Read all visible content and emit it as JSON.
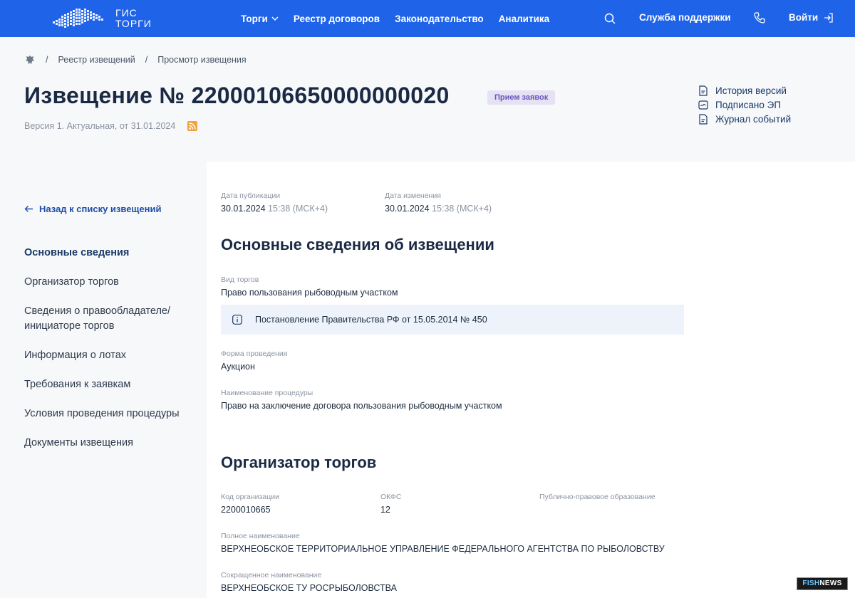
{
  "topbar": {
    "logo_text": [
      "ГИС",
      "ТОРГИ"
    ],
    "nav": [
      {
        "label": "Торги",
        "has_dropdown": true
      },
      {
        "label": "Реестр договоров"
      },
      {
        "label": "Законодательство"
      },
      {
        "label": "Аналитика"
      }
    ],
    "support_label": "Служба поддержки",
    "login_label": "Войти"
  },
  "breadcrumb": {
    "items": [
      "Реестр извещений",
      "Просмотр извещения"
    ],
    "separator": "/"
  },
  "notice": {
    "title": "Извещение № 22000106650000000020",
    "status_badge": "Прием заявок",
    "version_text": "Версия 1. Актуальная, от 31.01.2024"
  },
  "header_links": [
    {
      "label": "История версий",
      "icon": "document-icon"
    },
    {
      "label": "Подписано ЭП",
      "icon": "signature-icon"
    },
    {
      "label": "Журнал событий",
      "icon": "document-icon"
    }
  ],
  "sidebar": {
    "back_label": "Назад к списку извещений",
    "items": [
      {
        "label": "Основные сведения",
        "active": true
      },
      {
        "label": "Организатор торгов"
      },
      {
        "label": "Сведения о правообладателе/ инициаторе торгов"
      },
      {
        "label": "Информация о лотах"
      },
      {
        "label": "Требования к заявкам"
      },
      {
        "label": "Условия проведения процедуры"
      },
      {
        "label": "Документы извещения"
      }
    ]
  },
  "main": {
    "publication": {
      "label": "Дата публикации",
      "date": "30.01.2024",
      "time": "15:38 (МСК+4)"
    },
    "modified": {
      "label": "Дата изменения",
      "date": "30.01.2024",
      "time": "15:38 (МСК+4)"
    },
    "section1_title": "Основные сведения об извещении",
    "auction_type": {
      "label": "Вид торгов",
      "value": "Право пользования рыбоводным участком"
    },
    "info_note": "Постановление Правительства РФ от 15.05.2014 № 450",
    "form": {
      "label": "Форма проведения",
      "value": "Аукцион"
    },
    "procedure_name": {
      "label": "Наименование процедуры",
      "value": "Право на заключение договора пользования рыбоводным участком"
    },
    "section2_title": "Организатор торгов",
    "org_code": {
      "label": "Код организации",
      "value": "2200010665"
    },
    "okfs": {
      "label": "ОКФС",
      "value": "12"
    },
    "public_entity": {
      "label": "Публично-правовое образование",
      "value": ""
    },
    "full_name": {
      "label": "Полное наименование",
      "value": "ВЕРХНЕОБСКОЕ ТЕРРИТОРИАЛЬНОЕ УПРАВЛЕНИЕ ФЕДЕРАЛЬНОГО АГЕНТСТВА ПО РЫБОЛОВСТВУ"
    },
    "short_name": {
      "label": "Сокращенное наименование",
      "value": "ВЕРХНЕОБСКОЕ ТУ РОСРЫБОЛОВСТВА"
    }
  },
  "watermark": {
    "part1": "FISH",
    "part2": "NEWS"
  },
  "colors": {
    "topbar": "#1f63e8",
    "badge_bg": "#e6e1f5",
    "badge_text": "#6b57b8",
    "link": "#1f4fa8",
    "info_bg": "#eef3fb"
  }
}
